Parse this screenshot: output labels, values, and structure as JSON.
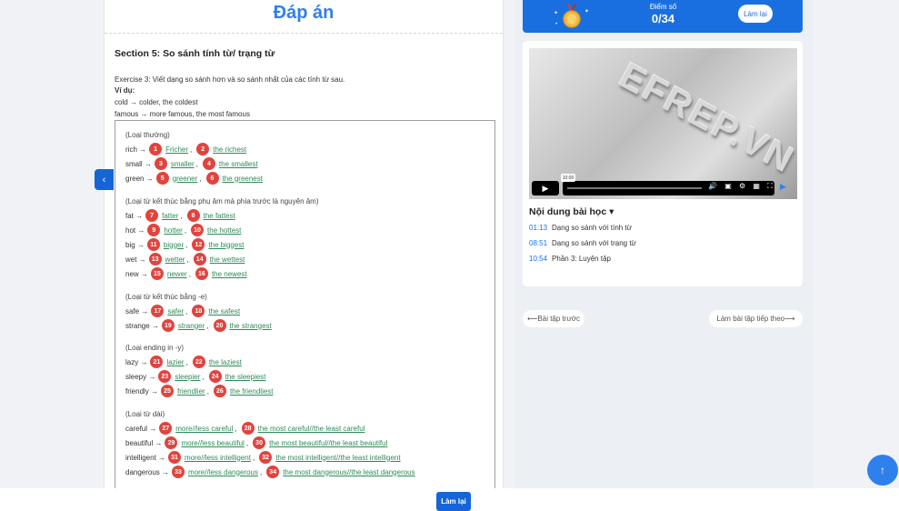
{
  "main": {
    "title": "Đáp án",
    "section_title": "Section 5: So sánh tính từ/ trạng từ",
    "exercise": "Exercise 3: Viết dạng so sánh hơn và so sánh nhất của các tính từ sau.",
    "example_label": "Ví dụ:",
    "example_1": "cold → colder, the coldest",
    "example_2": "famous → more famous, the most famous",
    "groups": [
      {
        "label": "(Loại thường)",
        "rows": [
          {
            "word": "rich →",
            "n1": "1",
            "a1": "Fricher",
            "n2": "2",
            "a2": "the richest"
          },
          {
            "word": "small →",
            "n1": "3",
            "a1": "smaller",
            "n2": "4",
            "a2": "the smallest"
          },
          {
            "word": "green →",
            "n1": "5",
            "a1": "greener",
            "n2": "6",
            "a2": "the greenest"
          }
        ]
      },
      {
        "label": "(Loại từ kết thúc bằng phụ âm mà phía trước là nguyên âm)",
        "rows": [
          {
            "word": "fat →",
            "n1": "7",
            "a1": "fatter",
            "n2": "8",
            "a2": "the fattest"
          },
          {
            "word": "hot →",
            "n1": "9",
            "a1": "hotter",
            "n2": "10",
            "a2": "the hottest"
          },
          {
            "word": "big →",
            "n1": "11",
            "a1": "bigger",
            "n2": "12",
            "a2": "the biggest"
          },
          {
            "word": "wet →",
            "n1": "13",
            "a1": "wetter",
            "n2": "14",
            "a2": "the wettest"
          },
          {
            "word": "new →",
            "n1": "15",
            "a1": "newer",
            "n2": "16",
            "a2": "the newest"
          }
        ]
      },
      {
        "label": "(Loại từ kết thúc bằng -e)",
        "rows": [
          {
            "word": "safe →",
            "n1": "17",
            "a1": "safer",
            "n2": "18",
            "a2": "the safest"
          },
          {
            "word": "strange →",
            "n1": "19",
            "a1": "stranger",
            "n2": "20",
            "a2": "the strangest"
          }
        ]
      },
      {
        "label": "(Loại ending in -y)",
        "rows": [
          {
            "word": "lazy →",
            "n1": "21",
            "a1": "lazier",
            "n2": "22",
            "a2": "the laziest"
          },
          {
            "word": "sleepy →",
            "n1": "23",
            "a1": "sleepier",
            "n2": "24",
            "a2": "the sleepiest"
          },
          {
            "word": "friendly →",
            "n1": "25",
            "a1": "friendlier",
            "n2": "26",
            "a2": "the friendliest"
          }
        ]
      },
      {
        "label": "(Loại từ dài)",
        "rows": [
          {
            "word": "careful →",
            "n1": "27",
            "a1": "more//less careful",
            "n2": "28",
            "a2": "the most careful//the least careful"
          },
          {
            "word": "beautiful →",
            "n1": "29",
            "a1": "more//less beautiful",
            "n2": "30",
            "a2": "the most beautiful//the least beautiful"
          },
          {
            "word": "intelligent →",
            "n1": "31",
            "a1": "more//less intelligent",
            "n2": "32",
            "a2": "the most intelligent//the least intelligent"
          },
          {
            "word": "dangerous →",
            "n1": "33",
            "a1": "more//less dangerous",
            "n2": "34",
            "a2": "the most dangerous//the least dangerous"
          }
        ]
      }
    ]
  },
  "score": {
    "label": "Điểm số",
    "value": "0/34",
    "retry": "Làm lại"
  },
  "video": {
    "logo": "EFREP.VN",
    "time_tip": "10:00",
    "content_header": "Nội dung bài học",
    "lessons": [
      {
        "time": "01:13",
        "title": "Dạng so sánh với tính từ"
      },
      {
        "time": "08:51",
        "title": "Dạng so sánh với trạng từ"
      },
      {
        "time": "10:54",
        "title": "Phần 3: Luyện tập"
      }
    ]
  },
  "nav": {
    "prev": "⟵Bài tập trước",
    "next": "Làm bài tập tiếp theo⟶"
  },
  "bottom": {
    "retry": "Làm lại"
  },
  "colors": {
    "accent": "#1565d8",
    "badge": "#e0443e",
    "answer": "#2e8b57"
  },
  "icons": {
    "play": "play-icon",
    "collapse": "chevron-left-icon",
    "scroll_top": "arrow-up-icon"
  }
}
